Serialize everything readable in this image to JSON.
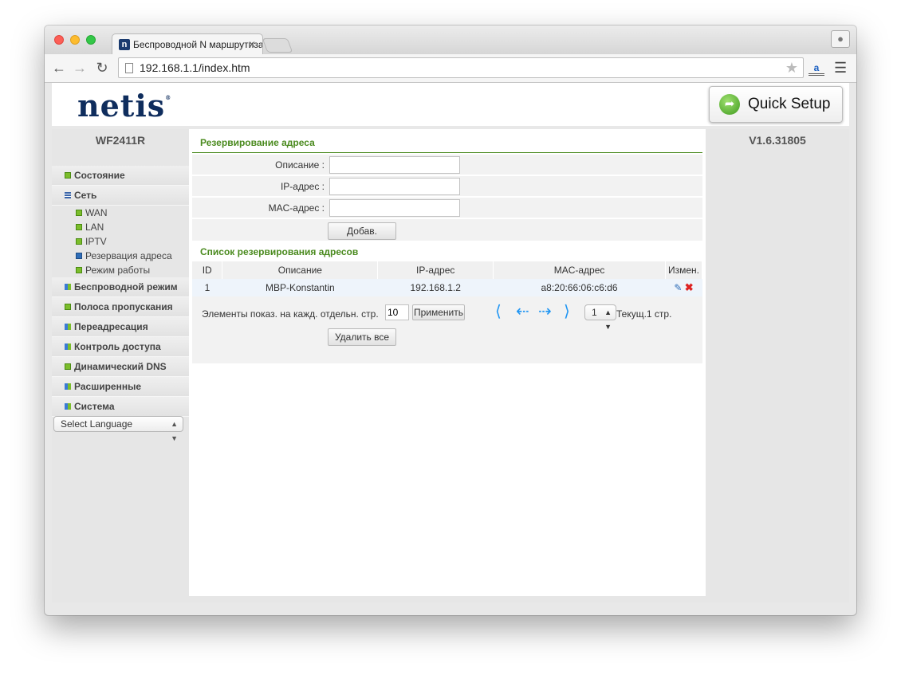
{
  "browser": {
    "tab_title": "Беспроводной N маршрутизатор",
    "tab_close": "✕",
    "url": "192.168.1.1/index.htm"
  },
  "header": {
    "logo": "netis",
    "logo_mark": "®",
    "quick_setup": "Quick Setup"
  },
  "sidebar": {
    "model": "WF2411R",
    "items": [
      {
        "label": "Состояние",
        "icon": "green-square-icon"
      },
      {
        "label": "Сеть",
        "icon": "lines-icon"
      },
      {
        "label": "Беспроводной режим",
        "icon": "grid-icon"
      },
      {
        "label": "Полоса пропускания",
        "icon": "green-square-icon"
      },
      {
        "label": "Переадресация",
        "icon": "grid-icon"
      },
      {
        "label": "Контроль доступа",
        "icon": "grid-icon"
      },
      {
        "label": "Динамический DNS",
        "icon": "green-square-icon"
      },
      {
        "label": "Расширенные",
        "icon": "grid-icon"
      },
      {
        "label": "Система",
        "icon": "grid-icon"
      }
    ],
    "sub_items": [
      {
        "label": "WAN"
      },
      {
        "label": "LAN"
      },
      {
        "label": "IPTV"
      },
      {
        "label": "Резервация адреса",
        "active": true
      },
      {
        "label": "Режим работы"
      }
    ],
    "language": "Select Language"
  },
  "version": "V1.6.31805",
  "reservation": {
    "title": "Резервирование адреса",
    "description_label": "Описание :",
    "ip_label": "IP-адрес :",
    "mac_label": "MAC-адрес :",
    "description_value": "",
    "ip_value": "",
    "mac_value": "",
    "add_button": "Добав."
  },
  "list": {
    "title": "Список резервирования адресов",
    "columns": [
      "ID",
      "Описание",
      "IP-адрес",
      "MAC-адрес",
      "Измен."
    ],
    "rows": [
      {
        "id": "1",
        "description": "MBP-Konstantin",
        "ip": "192.168.1.2",
        "mac": "a8:20:66:06:c6:d6"
      }
    ],
    "per_page_text": "Элементы показ. на кажд. отдельн. стр.",
    "per_page_value": "10",
    "apply_button": "Применить",
    "page_value": "1",
    "current_page_text": "Текущ.1 стр.",
    "delete_all_button": "Удалить все"
  },
  "colors": {
    "accent_green": "#4a8a1e",
    "logo_navy": "#0f2d5d",
    "pager_blue": "#2196f3"
  }
}
